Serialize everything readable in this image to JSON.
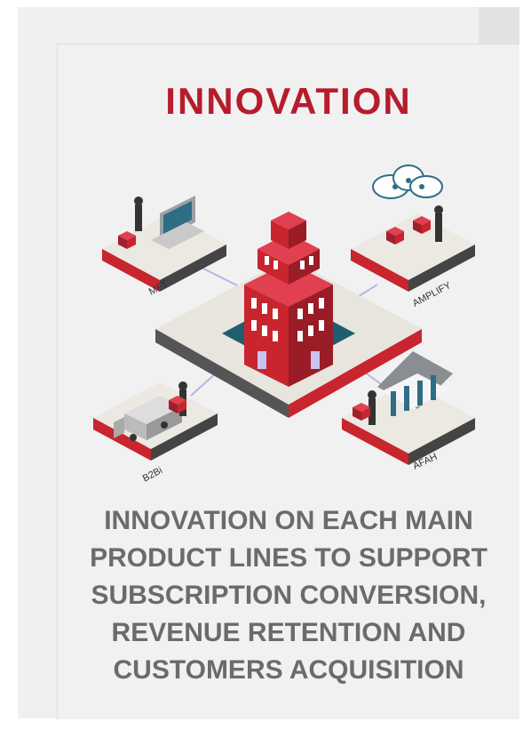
{
  "title": "INNOVATION",
  "illustration": {
    "labels": {
      "mft": "MFT",
      "amplify": "AMPLIFY",
      "b2bi": "B2Bi",
      "afah": "AFAH"
    }
  },
  "caption_lines": [
    "INNOVATION ON EACH MAIN",
    "PRODUCT LINES TO SUPPORT",
    "SUBSCRIPTION CONVERSION,",
    "REVENUE RETENTION AND",
    "CUSTOMERS ACQUISITION"
  ],
  "colors": {
    "accent": "#b71c2b",
    "caption": "#6b6b6b",
    "background": "#f1f1f1"
  }
}
